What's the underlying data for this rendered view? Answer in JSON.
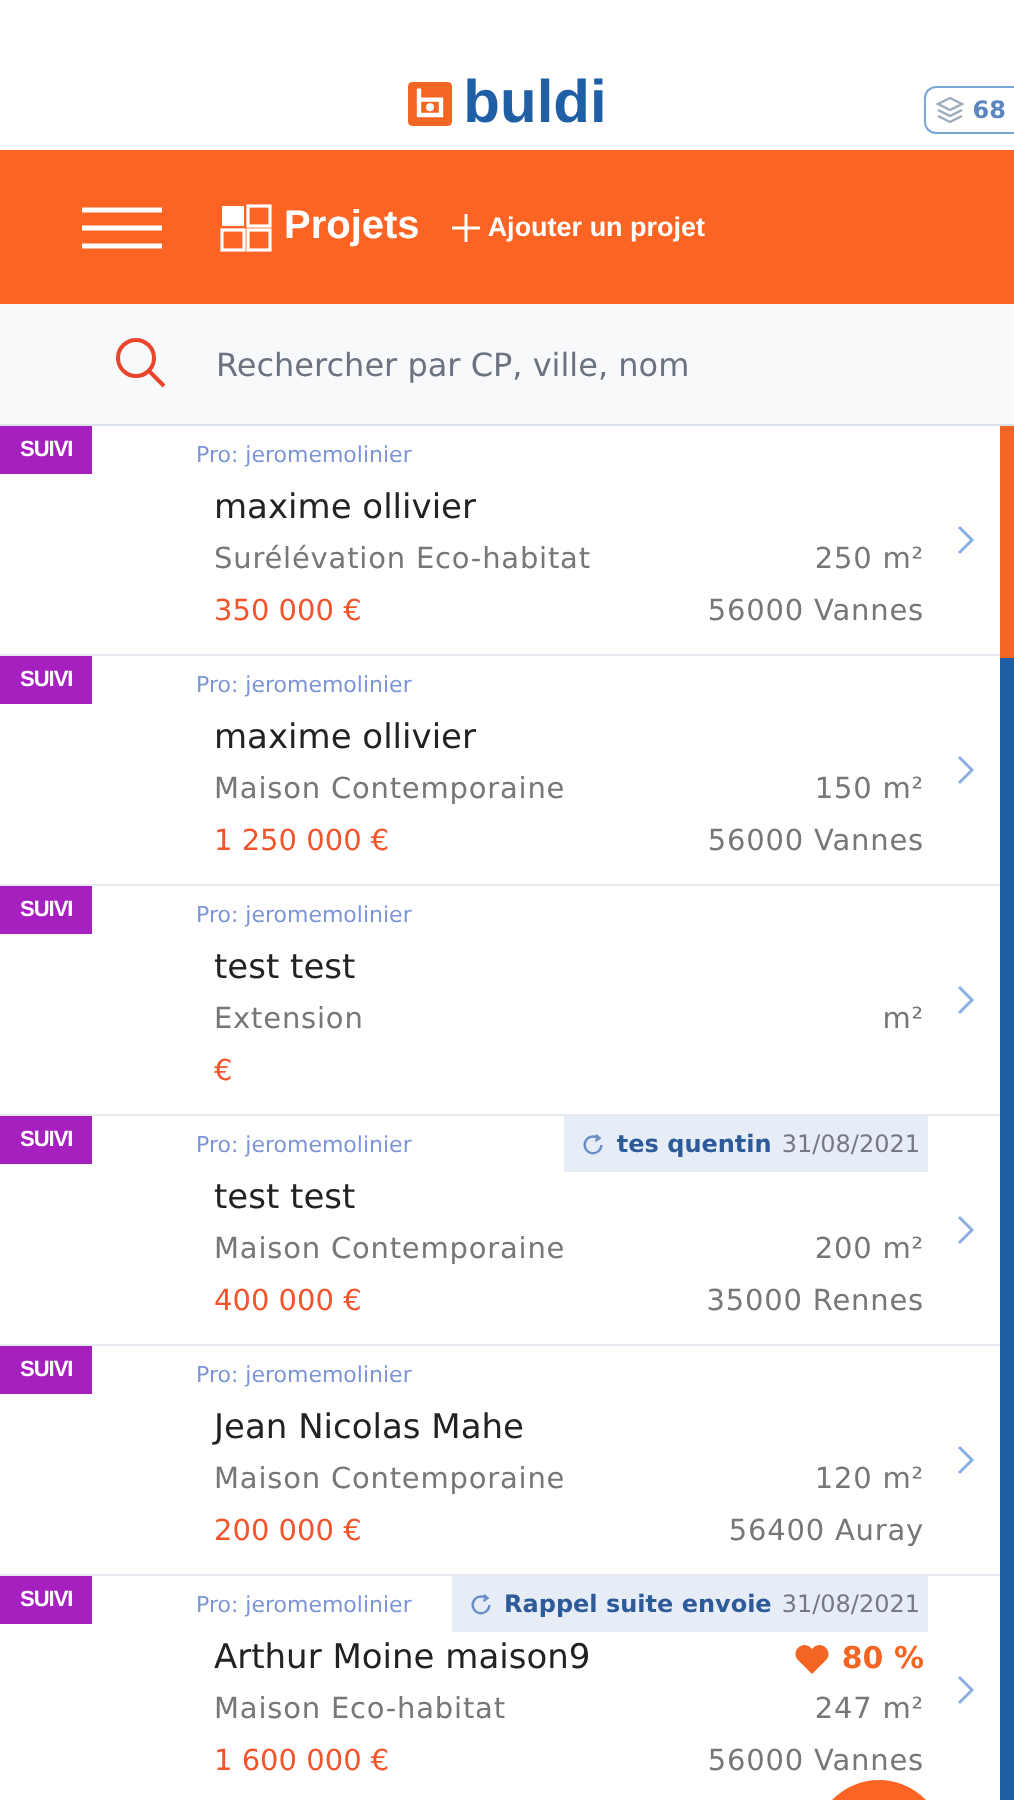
{
  "header": {
    "logo_text": "buldi",
    "counter": "68"
  },
  "toolbar": {
    "title": "Projets",
    "add_label": "Ajouter un projet"
  },
  "search": {
    "placeholder": "Rechercher par CP, ville, nom"
  },
  "projects": [
    {
      "tag": "SUIVI",
      "pro": "Pro: jeromemolinier",
      "name": "maxime ollivier",
      "type": "Surélévation Eco-habitat",
      "area": "250 m²",
      "price": "350 000 €",
      "city": "56000 Vannes"
    },
    {
      "tag": "SUIVI",
      "pro": "Pro: jeromemolinier",
      "name": "maxime ollivier",
      "type": "Maison Contemporaine",
      "area": "150 m²",
      "price": "1 250 000 €",
      "city": "56000 Vannes"
    },
    {
      "tag": "SUIVI",
      "pro": "Pro: jeromemolinier",
      "name": "test test",
      "type": "Extension",
      "area": "m²",
      "price": "€"
    },
    {
      "tag": "SUIVI",
      "pro": "Pro: jeromemolinier",
      "reminder": {
        "text": "tes quentin",
        "date": "31/08/2021"
      },
      "name": "test test",
      "type": "Maison Contemporaine",
      "area": "200 m²",
      "price": "400 000 €",
      "city": "35000 Rennes"
    },
    {
      "tag": "SUIVI",
      "pro": "Pro: jeromemolinier",
      "name": "Jean Nicolas Mahe",
      "type": "Maison Contemporaine",
      "area": "120 m²",
      "price": "200 000 €",
      "city": "56400 Auray"
    },
    {
      "tag": "SUIVI",
      "pro": "Pro: jeromemolinier",
      "reminder": {
        "text": "Rappel suite envoie",
        "date": "31/08/2021"
      },
      "name": "Arthur Moine maison9",
      "score": "80 %",
      "type": "Maison Eco-habitat",
      "area": "247 m²",
      "price": "1 600 000 €",
      "city": "56000 Vannes"
    }
  ]
}
